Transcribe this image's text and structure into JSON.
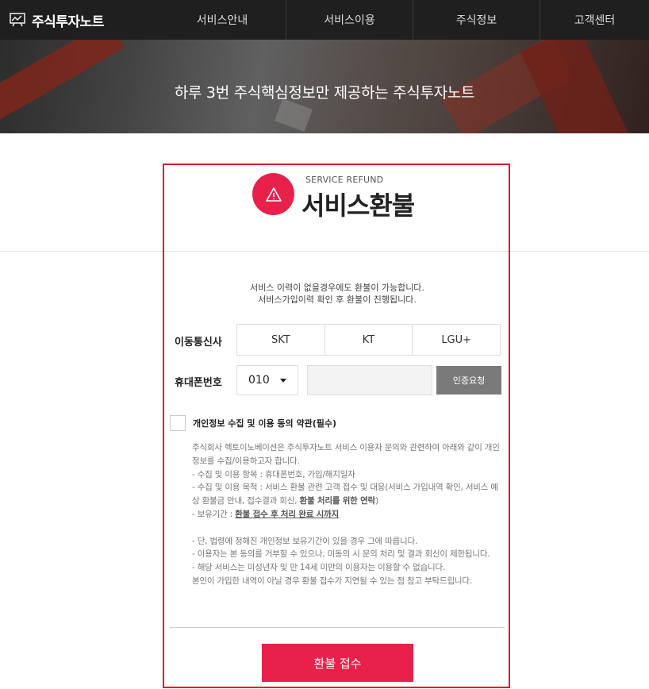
{
  "nav": {
    "logo_text": "주식투자노트",
    "items": [
      {
        "label": "서비스안내"
      },
      {
        "label": "서비스이용"
      },
      {
        "label": "주식정보"
      },
      {
        "label": "고객센터"
      }
    ]
  },
  "hero": {
    "title": "하루 3번 주식핵심정보만 제공하는 주식투자노트"
  },
  "refund": {
    "eng_title": "SERVICE REFUND",
    "kor_title": "서비스환불",
    "notice_line1": "서비스 이력이 없을경우에도 환불이 가능합니다.",
    "notice_line2": "서비스가입이력 확인 후 환불이 진행됩니다."
  },
  "form": {
    "carrier_label": "이동통신사",
    "carriers": [
      "SKT",
      "KT",
      "LGU+"
    ],
    "phone_label": "휴대폰번호",
    "phone_prefix": "010",
    "phone_value": "",
    "verify_label": "인증요청"
  },
  "agreement": {
    "title": "개인정보 수집 및 이용 동의 약관(필수)",
    "p1": "주식회사 헥토이노베이션은 주식투자노트 서비스 이용자 문의와 관련하여 아래와 같이 개인정보를 수집/이용하고자 합니다.",
    "p2": "- 수집 및 이용 항목 : 휴대폰번호, 가입/해지일자",
    "p3_a": "- 수집 및 이용 목적 : 서비스 환불 관련 고객 접수 및 대응(서비스 가입내역 확인, 서비스 예상 환불금 안내, 접수결과 회신, ",
    "p3_b": "환불 처리를 위한 연락",
    "p3_c": ")",
    "p4_a": "- 보유기간 : ",
    "p4_b": "환불 접수 후 처리 완료 시까지",
    "p5": "- 단, 법령에 정해진 개인정보 보유기간이 있을 경우 그에 따릅니다.",
    "p6": "- 이용자는 본 동의를 거부할 수 있으나, 미동의 시 문의 처리 및 결과 회신이 제한됩니다.",
    "p7": "- 해당 서비스는 미성년자 및 만 14세 미만의 이용자는 이용할 수 없습니다.",
    "p8": "본인이 가입한 내역이 아닐 경우 환불 접수가 지연될 수 있는 점 참고 부탁드립니다."
  },
  "submit": {
    "label": "환불 접수"
  },
  "colors": {
    "accent": "#e8214a",
    "frame": "#e3162b",
    "nav_bg": "#1f1f1f"
  }
}
